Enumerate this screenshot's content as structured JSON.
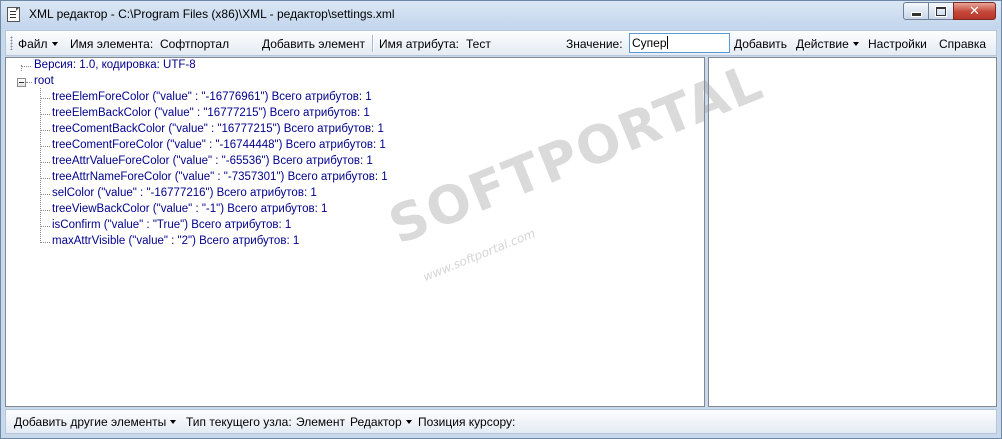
{
  "window": {
    "title": "XML редактор - C:\\Program Files (x86)\\XML - редактор\\settings.xml",
    "close_glyph": "✕"
  },
  "toolbar": {
    "file_menu": "Файл",
    "element_name_label": "Имя элемента:",
    "element_name_value": "Софтпортал",
    "add_element_button": "Добавить элемент",
    "attribute_name_label": "Имя атрибута:",
    "attribute_name_value": "Тест",
    "value_label": "Значение:",
    "value_input": "Супер",
    "add_button": "Добавить",
    "action_menu": "Действие",
    "settings_button": "Настройки",
    "help_button": "Справка"
  },
  "tree": {
    "declaration": "Версия: 1.0, кодировка: UTF-8",
    "root": "root",
    "children": [
      "treeElemForeColor (\"value\" : \"-16776961\") Всего атрибутов: 1",
      "treeElemBackColor (\"value\" : \"16777215\") Всего атрибутов: 1",
      "treeComentBackColor (\"value\" : \"16777215\") Всего атрибутов: 1",
      "treeComentForeColor (\"value\" : \"-16744448\") Всего атрибутов: 1",
      "treeAttrValueForeColor (\"value\" : \"-65536\") Всего атрибутов: 1",
      "treeAttrNameForeColor (\"value\" : \"-7357301\") Всего атрибутов: 1",
      "selColor (\"value\" : \"-16777216\") Всего атрибутов: 1",
      "treeViewBackColor (\"value\" : \"-1\") Всего атрибутов: 1",
      "isConfirm (\"value\" : \"True\") Всего атрибутов: 1",
      "maxAttrVisible (\"value\" : \"2\") Всего атрибутов: 1"
    ]
  },
  "watermark": {
    "logo": "SOFTPORTAL",
    "url": "www.softportal.com"
  },
  "statusbar": {
    "add_other_elements": "Добавить другие элементы",
    "node_type_label": "Тип текущего узла:",
    "node_type_value": "Элемент",
    "editor_menu": "Редактор",
    "cursor_position_label": "Позиция курсору:"
  },
  "colors": {
    "tree_text": "#00008b",
    "window_frame": "#c9d9ec",
    "input_focus_border": "#5b9bd5"
  }
}
